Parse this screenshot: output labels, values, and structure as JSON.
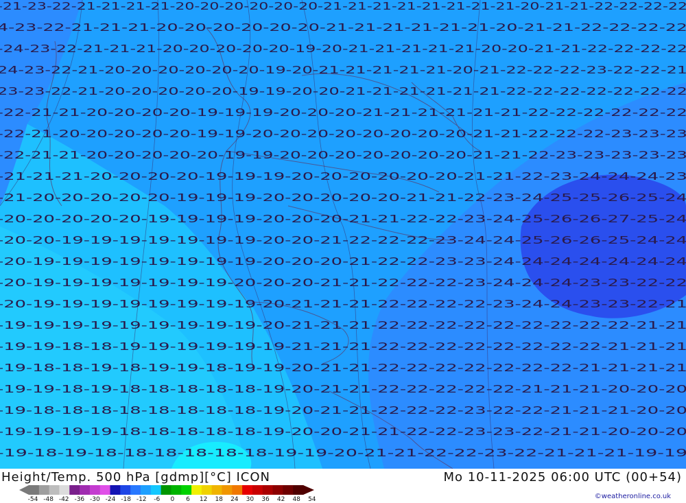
{
  "footer": {
    "title": "Height/Temp. 500 hPa [gdmp][°C] ICON",
    "datetime": "Mo 10-11-2025 06:00 UTC (00+54)",
    "copyright": "©weatheronline.co.uk"
  },
  "colorbar": {
    "ticks": [
      "-54",
      "-48",
      "-42",
      "-36",
      "-30",
      "-24",
      "-18",
      "-12",
      "-6",
      "0",
      "6",
      "12",
      "18",
      "24",
      "30",
      "36",
      "42",
      "48",
      "54"
    ],
    "colors": [
      "#7a7a7a",
      "#9e9e9e",
      "#bdbdbd",
      "#dcdcdc",
      "#7a1f8c",
      "#a02cb0",
      "#c43cd0",
      "#e050e8",
      "#1414b4",
      "#1e46e6",
      "#2878ff",
      "#1ea0ff",
      "#14c8ff",
      "#009600",
      "#00b400",
      "#00d200",
      "#f0f000",
      "#f0d200",
      "#f0b400",
      "#f09600",
      "#f07800",
      "#e60000",
      "#c80000",
      "#aa0000",
      "#8c0000",
      "#6e0000",
      "#500000"
    ]
  },
  "map_colors": {
    "warm_cyan": "#1ec8ff",
    "mid_blue": "#1ea0ff",
    "deep_blue": "#2878ff",
    "core_blue": "#1e46e6",
    "bright_cyan": "#14e6ff",
    "border_line": "#5a3a6a",
    "contour": "#2a1a4a"
  },
  "isotherm_labels": [
    {
      "row": 0,
      "text": "-21-23-22-21-21-21-21-20-20-20-20-20-20-21-21-21-21-21-21-21-21-20-21-21-22-22-22-22"
    },
    {
      "row": 1,
      "text": "4-23-22-21-21-21-20-20-20-20-20-20-21-21-21-21-21-21-20-21-21-22-22-22-22"
    },
    {
      "row": 2,
      "text": "-24-23-22-21-21-21-20-20-20-20-20-19-20-21-21-21-21-21-20-20-21-21-22-22-22-22"
    },
    {
      "row": 3,
      "text": "24-23-22-21-20-20-20-20-20-20-19-20-21-21-21-21-21-20-21-22-22-22-23-22-22-21"
    },
    {
      "row": 4,
      "text": "23-23-22-21-20-20-20-20-20-19-19-20-20-21-21-21-21-21-21-22-22-22-22-22-22-22"
    },
    {
      "row": 5,
      "text": "-22-21-21-20-20-20-20-19-19-19-20-20-20-21-21-21-21-21-21-22-22-22-22-22-22"
    },
    {
      "row": 6,
      "text": "-22-21-20-20-20-20-20-19-19-20-20-20-20-20-20-20-20-21-21-22-22-22-23-23-23"
    },
    {
      "row": 7,
      "text": "-22-21-21-20-20-20-20-20-19-19-20-20-20-20-20-20-20-21-21-22-23-23-23-23-23"
    },
    {
      "row": 8,
      "text": "-21-21-21-20-20-20-20-19-19-19-20-20-20-20-20-20-21-21-22-23-24-24-24-23"
    },
    {
      "row": 9,
      "text": "-21-20-20-20-20-20-19-19-19-20-20-20-20-20-21-21-22-23-24-25-25-26-25-24"
    },
    {
      "row": 10,
      "text": "-20-20-20-20-20-19-19-19-19-20-20-20-21-21-22-22-23-24-25-26-26-27-25-24"
    },
    {
      "row": 11,
      "text": "-20-20-19-19-19-19-19-19-19-20-20-21-22-22-22-23-24-24-25-26-26-25-24-24"
    },
    {
      "row": 12,
      "text": "-20-19-19-19-19-19-19-19-19-20-20-20-21-22-22-23-23-24-24-24-24-24-24-24"
    },
    {
      "row": 13,
      "text": "-20-19-19-19-19-19-19-19-20-20-20-21-21-22-22-22-23-24-24-24-23-23-22-22"
    },
    {
      "row": 14,
      "text": "-20-19-19-19-19-19-19-19-19-20-21-21-21-22-22-22-22-23-24-24-23-23-22-21"
    },
    {
      "row": 15,
      "text": "-19-19-19-19-19-19-19-19-19-20-21-21-21-22-22-22-22-22-22-22-22-22-21-21"
    },
    {
      "row": 16,
      "text": "-19-19-18-18-19-19-19-19-19-19-21-21-21-22-22-22-22-22-22-22-22-21-21-21"
    },
    {
      "row": 17,
      "text": "-19-18-18-19-18-19-19-18-19-19-20-21-21-22-22-22-22-22-22-22-21-21-21-21"
    },
    {
      "row": 18,
      "text": "-19-19-18-19-18-18-18-18-18-19-20-21-21-22-22-22-22-22-21-21-21-20-20-20"
    },
    {
      "row": 19,
      "text": "-19-18-18-18-18-18-18-18-18-19-20-21-21-22-22-22-23-22-22-21-21-21-20-20"
    },
    {
      "row": 20,
      "text": "-19-19-19-19-18-18-18-18-18-19-20-20-21-21-22-22-23-23-22-21-21-20-20-20"
    },
    {
      "row": 21,
      "text": "-19-18-19-18-18-18-18-18-18-19-19-20-21-21-22-22-23-22-21-21-21-19-19"
    }
  ]
}
